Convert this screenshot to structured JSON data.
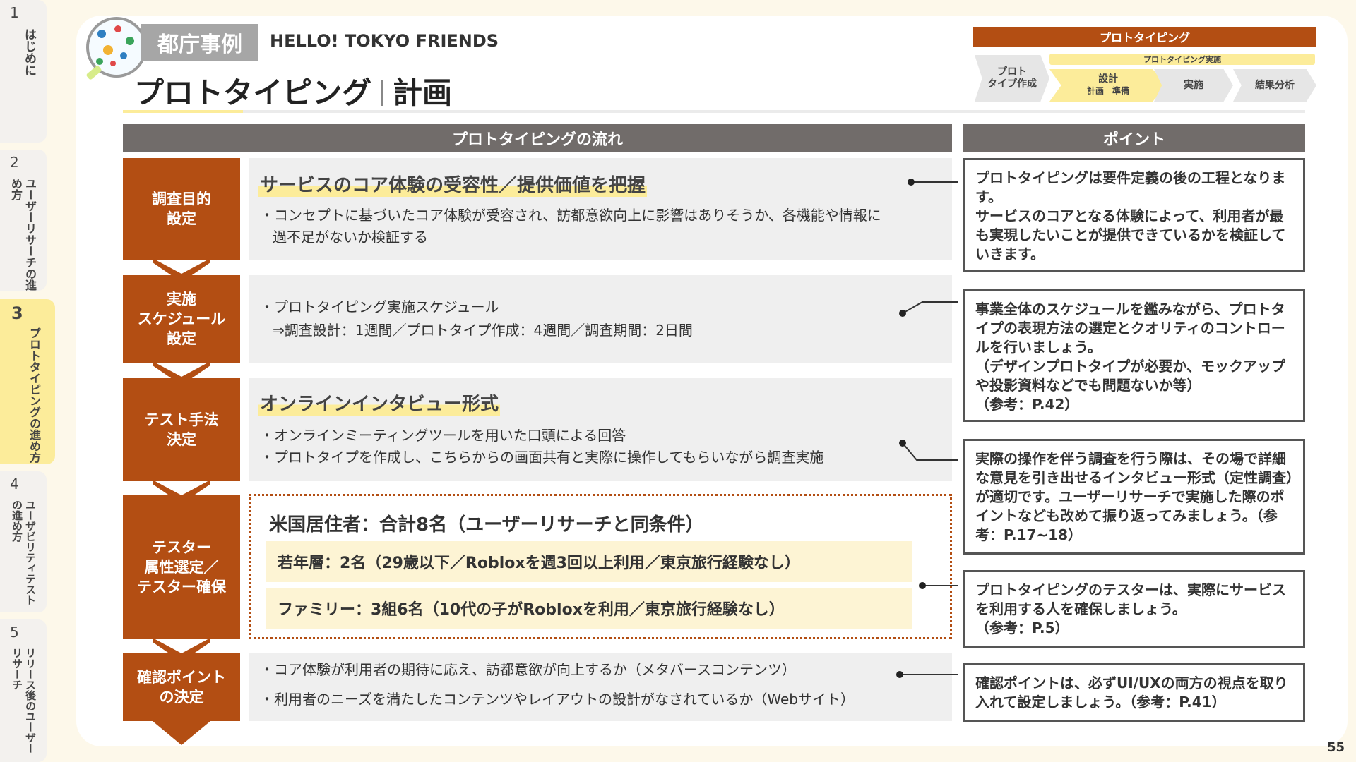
{
  "side_tabs": [
    {
      "num": "1",
      "label": "はじめに",
      "active": false
    },
    {
      "num": "2",
      "label": "ユーザーリサーチの進め方",
      "active": false
    },
    {
      "num": "3",
      "label": "プロトタイピングの進め方",
      "active": true
    },
    {
      "num": "4",
      "label": "ユーザビリティテストの進め方",
      "active": false
    },
    {
      "num": "5",
      "label": "リリース後のユーザーリサーチ",
      "active": false
    }
  ],
  "header": {
    "tag": "都庁事例",
    "project": "HELLO! TOKYO FRIENDS",
    "title_main": "プロトタイピング",
    "title_sub": "計画"
  },
  "process": {
    "bar": "プロトタイピング",
    "sub": "プロトタイピング実施",
    "steps": {
      "proto": "プロト\nタイプ作成",
      "design": "設計",
      "plan": "計画",
      "prep": "準備",
      "exec": "実施",
      "result": "結果分析"
    }
  },
  "flow_header": "プロトタイピングの流れ",
  "points_header": "ポイント",
  "steps": [
    {
      "label": "調査目的\n設定"
    },
    {
      "label": "実施\nスケジュール\n設定"
    },
    {
      "label": "テスト手法\n決定"
    },
    {
      "label": "テスター\n属性選定／\nテスター確保"
    },
    {
      "label": "確認ポイント\nの決定"
    }
  ],
  "panels": {
    "p1": {
      "heading": "サービスのコア体験の受容性／提供価値を把握",
      "line1": "・コンセプトに基づいたコア体験が受容され、訪都意欲向上に影響はありそうか、各機能や情報に",
      "line2": "過不足がないか検証する"
    },
    "p2": {
      "line1": "・プロトタイピング実施スケジュール",
      "line2": "⇒調査設計：1週間／プロトタイプ作成：4週間／調査期間：2日間"
    },
    "p3": {
      "heading": "オンラインインタビュー形式",
      "line1": "・オンラインミーティングツールを用いた口頭による回答",
      "line2": "・プロトタイプを作成し、こちらからの画面共有と実際に操作してもらいながら調査実施"
    },
    "p4": {
      "heading": "米国居住者：合計8名（ユーザーリサーチと同条件）",
      "row1": "若年層：2名（29歳以下／Robloxを週3回以上利用／東京旅行経験なし）",
      "row2": "ファミリー：3組6名（10代の子がRobloxを利用／東京旅行経験なし）"
    },
    "p5": {
      "line1": "・コア体験が利用者の期待に応え、訪都意欲が向上するか（メタバースコンテンツ）",
      "line2": "・利用者のニーズを満たしたコンテンツやレイアウトの設計がなされているか（Webサイト）"
    }
  },
  "points": [
    "プロトタイピングは要件定義の後の工程となります。\nサービスのコアとなる体験によって、利用者が最も実現したいことが提供できているかを検証していきます。",
    "事業全体のスケジュールを鑑みながら、プロトタイプの表現方法の選定とクオリティのコントロールを行いましょう。\n（デザインプロトタイプが必要か、モックアップや投影資料などでも問題ないか等）\n（参考：P.42）",
    "実際の操作を伴う調査を行う際は、その場で詳細な意見を引き出せるインタビュー形式（定性調査）が適切です。ユーザーリサーチで実施した際のポイントなども改めて振り返ってみましょう。（参考：P.17~18）",
    "プロトタイピングのテスターは、実際にサービスを利用する人を確保しましょう。\n（参考：P.5）",
    "確認ポイントは、必ずUI/UXの両方の視点を取り入れて設定しましょう。（参考：P.41）"
  ],
  "page_number": "55",
  "colors": {
    "brand": "#b34e13",
    "header_gray": "#716c6a",
    "highlight": "#fcec9a",
    "background": "#fdf8ea"
  }
}
